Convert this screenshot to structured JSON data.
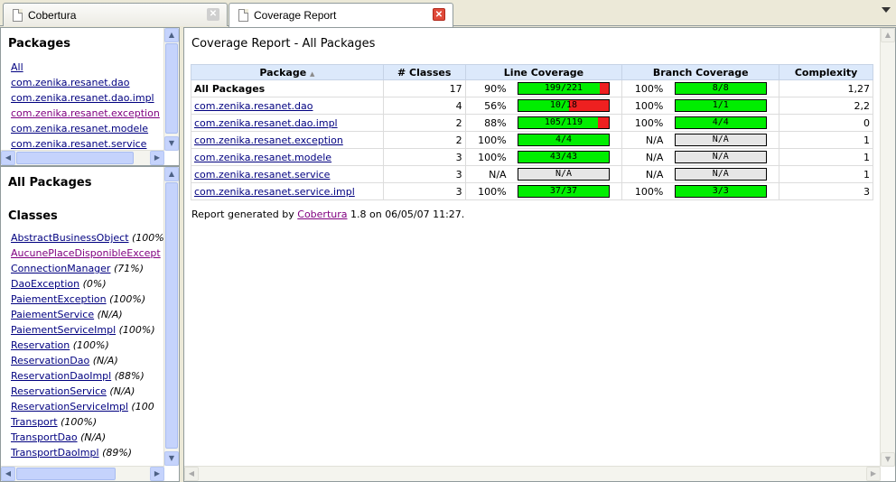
{
  "tabs": [
    {
      "label": "Cobertura",
      "active": false
    },
    {
      "label": "Coverage Report",
      "active": true
    }
  ],
  "packages_frame": {
    "title": "Packages",
    "items": [
      "All",
      "com.zenika.resanet.dao",
      "com.zenika.resanet.dao.impl",
      "com.zenika.resanet.exception",
      "com.zenika.resanet.modele",
      "com.zenika.resanet.service"
    ]
  },
  "classes_frame": {
    "scope_title": "All Packages",
    "title": "Classes",
    "items": [
      {
        "name": "AbstractBusinessObject",
        "coverage": "(100%"
      },
      {
        "name": "AucunePlaceDisponibleExcept",
        "coverage": ""
      },
      {
        "name": "ConnectionManager",
        "coverage": "(71%)"
      },
      {
        "name": "DaoException",
        "coverage": "(0%)"
      },
      {
        "name": "PaiementException",
        "coverage": "(100%)"
      },
      {
        "name": "PaiementService",
        "coverage": "(N/A)"
      },
      {
        "name": "PaiementServiceImpl",
        "coverage": "(100%)"
      },
      {
        "name": "Reservation",
        "coverage": "(100%)"
      },
      {
        "name": "ReservationDao",
        "coverage": "(N/A)"
      },
      {
        "name": "ReservationDaoImpl",
        "coverage": "(88%)"
      },
      {
        "name": "ReservationService",
        "coverage": "(N/A)"
      },
      {
        "name": "ReservationServiceImpl",
        "coverage": "(100"
      },
      {
        "name": "Transport",
        "coverage": "(100%)"
      },
      {
        "name": "TransportDao",
        "coverage": "(N/A)"
      },
      {
        "name": "TransportDaoImpl",
        "coverage": "(89%)"
      }
    ]
  },
  "report": {
    "title": "Coverage Report - All Packages",
    "columns": [
      "Package",
      "# Classes",
      "Line Coverage",
      "Branch Coverage",
      "Complexity"
    ],
    "sort_indicator": "▲",
    "rows": [
      {
        "package": "All Packages",
        "classes": "17",
        "line_pct": "90%",
        "line_ratio": 0.9,
        "line_text": "199/221",
        "branch_pct": "100%",
        "branch_ratio": 1.0,
        "branch_text": "8/8",
        "complexity": "1,27",
        "is_link": false
      },
      {
        "package": "com.zenika.resanet.dao",
        "classes": "4",
        "line_pct": "56%",
        "line_ratio": 0.56,
        "line_text": "10/18",
        "branch_pct": "100%",
        "branch_ratio": 1.0,
        "branch_text": "1/1",
        "complexity": "2,2",
        "is_link": true
      },
      {
        "package": "com.zenika.resanet.dao.impl",
        "classes": "2",
        "line_pct": "88%",
        "line_ratio": 0.88,
        "line_text": "105/119",
        "branch_pct": "100%",
        "branch_ratio": 1.0,
        "branch_text": "4/4",
        "complexity": "0",
        "is_link": true
      },
      {
        "package": "com.zenika.resanet.exception",
        "classes": "2",
        "line_pct": "100%",
        "line_ratio": 1.0,
        "line_text": "4/4",
        "branch_pct": "N/A",
        "branch_ratio": null,
        "branch_text": "N/A",
        "complexity": "1",
        "is_link": true
      },
      {
        "package": "com.zenika.resanet.modele",
        "classes": "3",
        "line_pct": "100%",
        "line_ratio": 1.0,
        "line_text": "43/43",
        "branch_pct": "N/A",
        "branch_ratio": null,
        "branch_text": "N/A",
        "complexity": "1",
        "is_link": true
      },
      {
        "package": "com.zenika.resanet.service",
        "classes": "3",
        "line_pct": "N/A",
        "line_ratio": null,
        "line_text": "N/A",
        "branch_pct": "N/A",
        "branch_ratio": null,
        "branch_text": "N/A",
        "complexity": "1",
        "is_link": true
      },
      {
        "package": "com.zenika.resanet.service.impl",
        "classes": "3",
        "line_pct": "100%",
        "line_ratio": 1.0,
        "line_text": "37/37",
        "branch_pct": "100%",
        "branch_ratio": 1.0,
        "branch_text": "3/3",
        "complexity": "3",
        "is_link": true
      }
    ],
    "footer_prefix": "Report generated by",
    "footer_link": "Cobertura",
    "footer_suffix": "1.8 on 06/05/07 11:27."
  },
  "colors": {
    "covered": "#00ee00",
    "uncovered": "#ee2020",
    "na": "#e6e6e6",
    "header": "#dce9fb"
  }
}
